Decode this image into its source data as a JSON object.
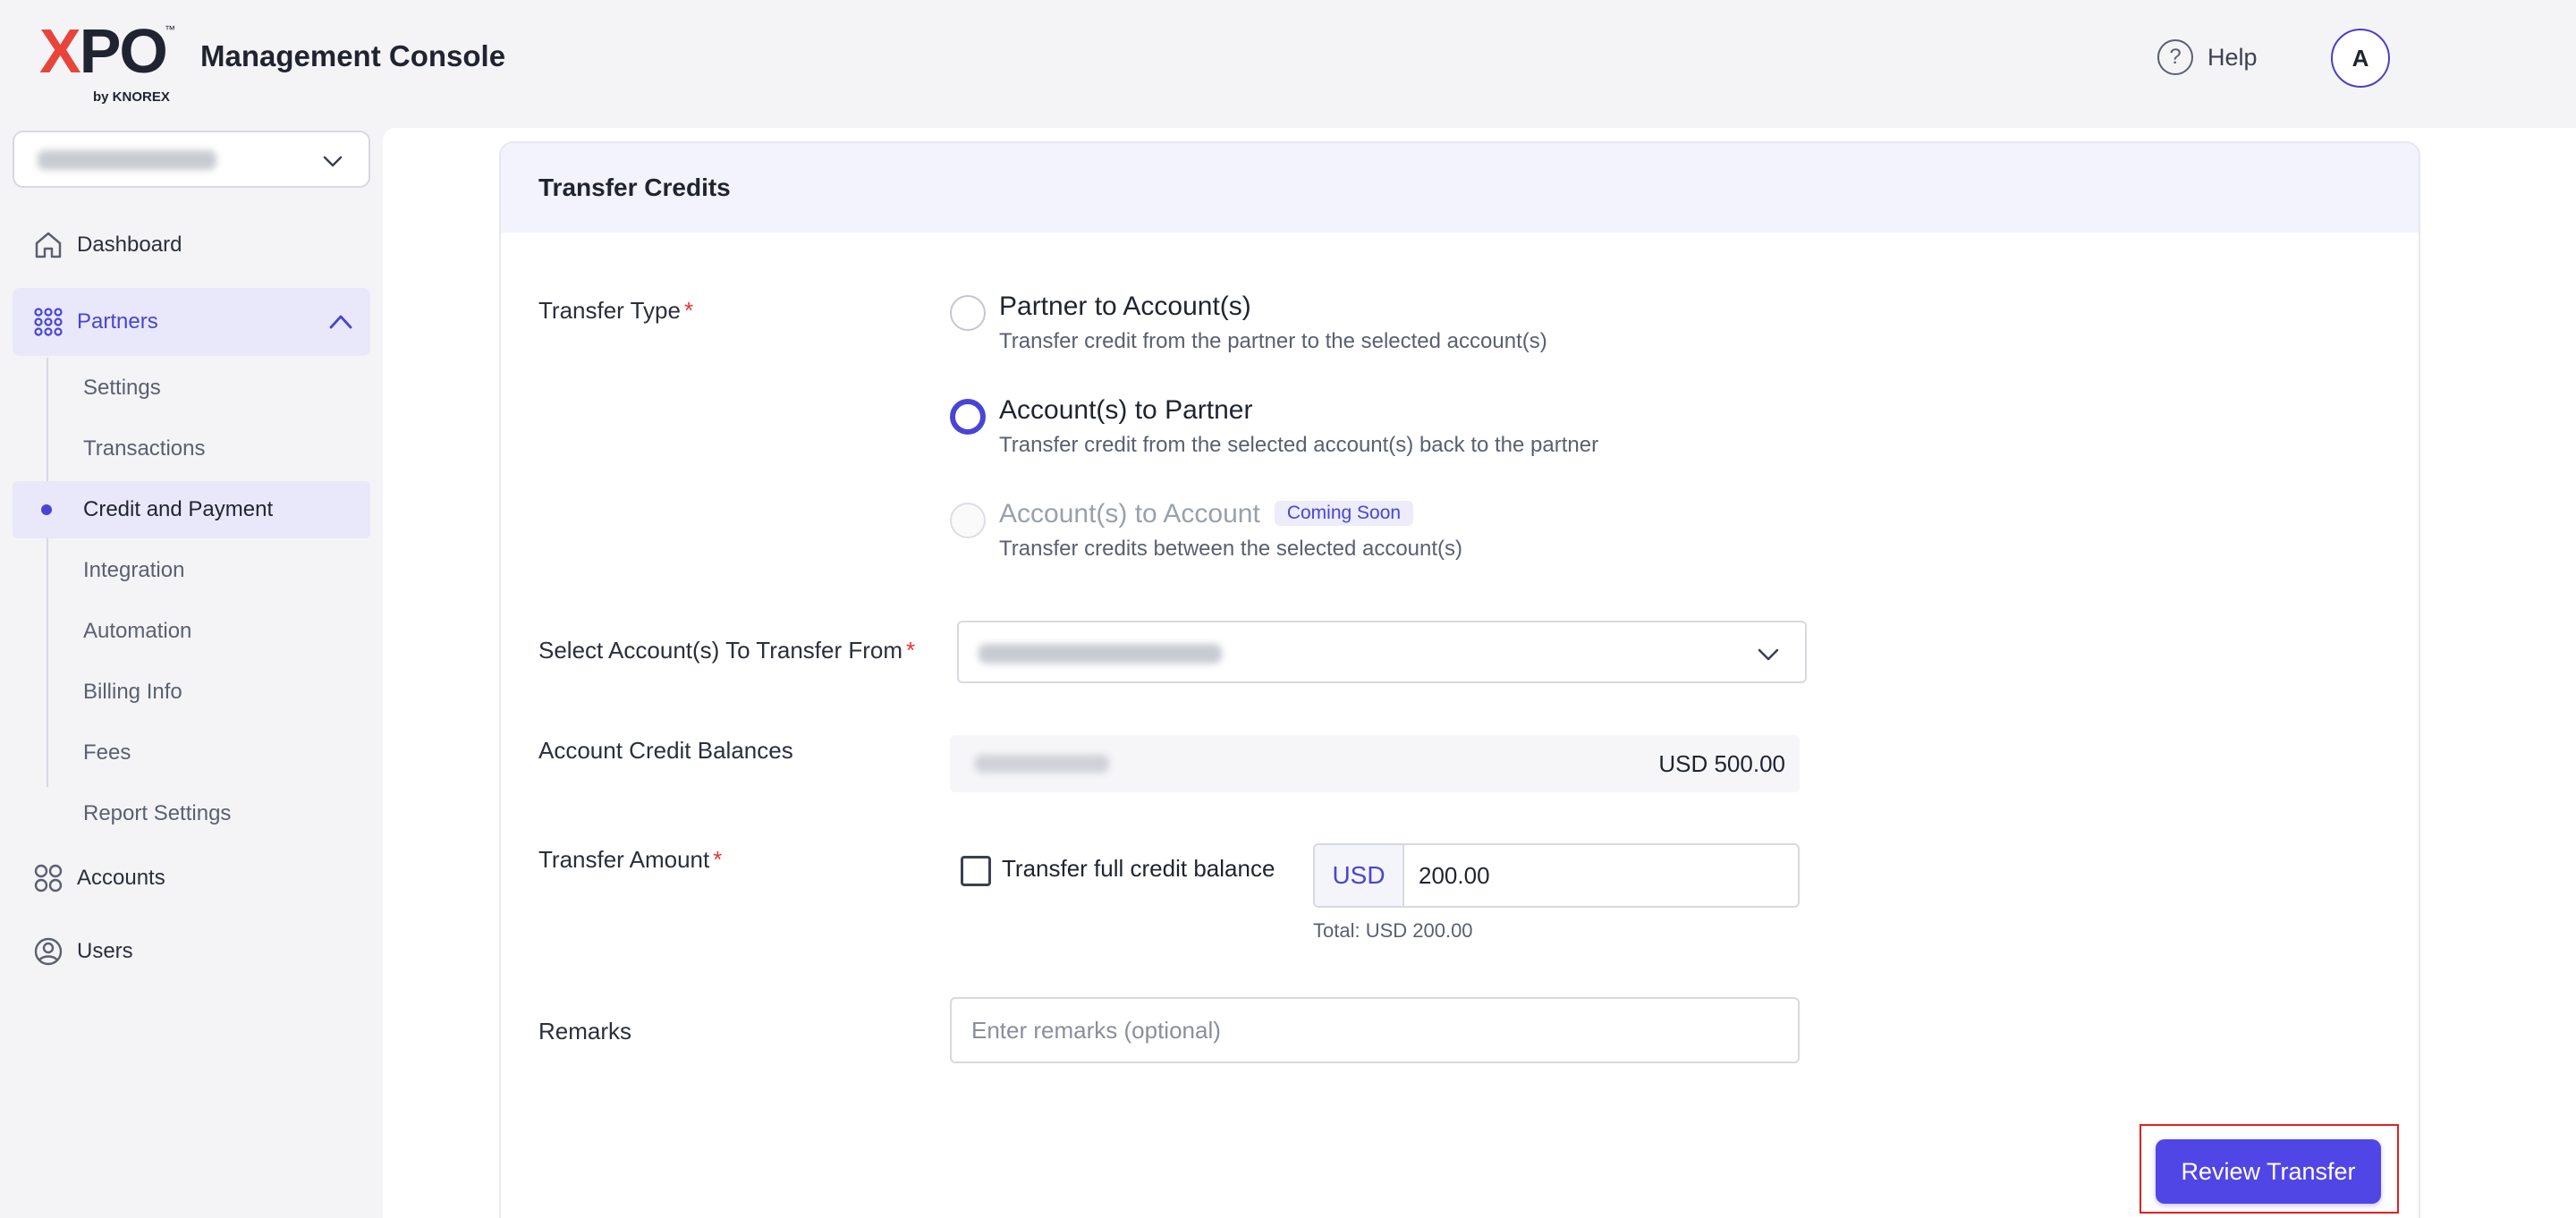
{
  "header": {
    "logo": {
      "xpo": "XPO",
      "tm": "™",
      "by": "by KNOREX"
    },
    "title": "Management Console",
    "help_label": "Help",
    "avatar_initial": "A"
  },
  "sidebar": {
    "items": [
      {
        "label": "Dashboard",
        "icon": "home-icon"
      },
      {
        "label": "Partners",
        "icon": "grid-dots-icon",
        "expanded": true
      },
      {
        "label": "Accounts",
        "icon": "four-circles-icon"
      },
      {
        "label": "Users",
        "icon": "user-circle-icon"
      }
    ],
    "sub_items": [
      {
        "label": "Settings"
      },
      {
        "label": "Transactions"
      },
      {
        "label": "Credit and Payment",
        "active": true
      },
      {
        "label": "Integration"
      },
      {
        "label": "Automation"
      },
      {
        "label": "Billing Info"
      },
      {
        "label": "Fees"
      },
      {
        "label": "Report Settings"
      }
    ]
  },
  "form": {
    "title": "Transfer Credits",
    "transfer_type": {
      "label": "Transfer Type",
      "options": [
        {
          "title": "Partner to Account(s)",
          "desc": "Transfer credit from the partner to the selected account(s)",
          "selected": false
        },
        {
          "title": "Account(s) to Partner",
          "desc": "Transfer credit from the selected account(s) back to the partner",
          "selected": true
        },
        {
          "title": "Account(s) to Account",
          "badge": "Coming Soon",
          "desc": "Transfer credits between the selected account(s)",
          "disabled": true
        }
      ]
    },
    "select_from": {
      "label": "Select Account(s) To Transfer From"
    },
    "balances": {
      "label": "Account Credit Balances",
      "amount": "USD 500.00"
    },
    "amount": {
      "label": "Transfer Amount",
      "full_balance_label": "Transfer full credit balance",
      "currency": "USD",
      "value": "200.00",
      "total": "Total: USD 200.00"
    },
    "remarks": {
      "label": "Remarks",
      "placeholder": "Enter remarks (optional)"
    },
    "submit_label": "Review Transfer"
  },
  "colors": {
    "accent": "#4a44d4",
    "button": "#5046e5",
    "required": "#e53535",
    "highlight_border": "#e02020"
  }
}
